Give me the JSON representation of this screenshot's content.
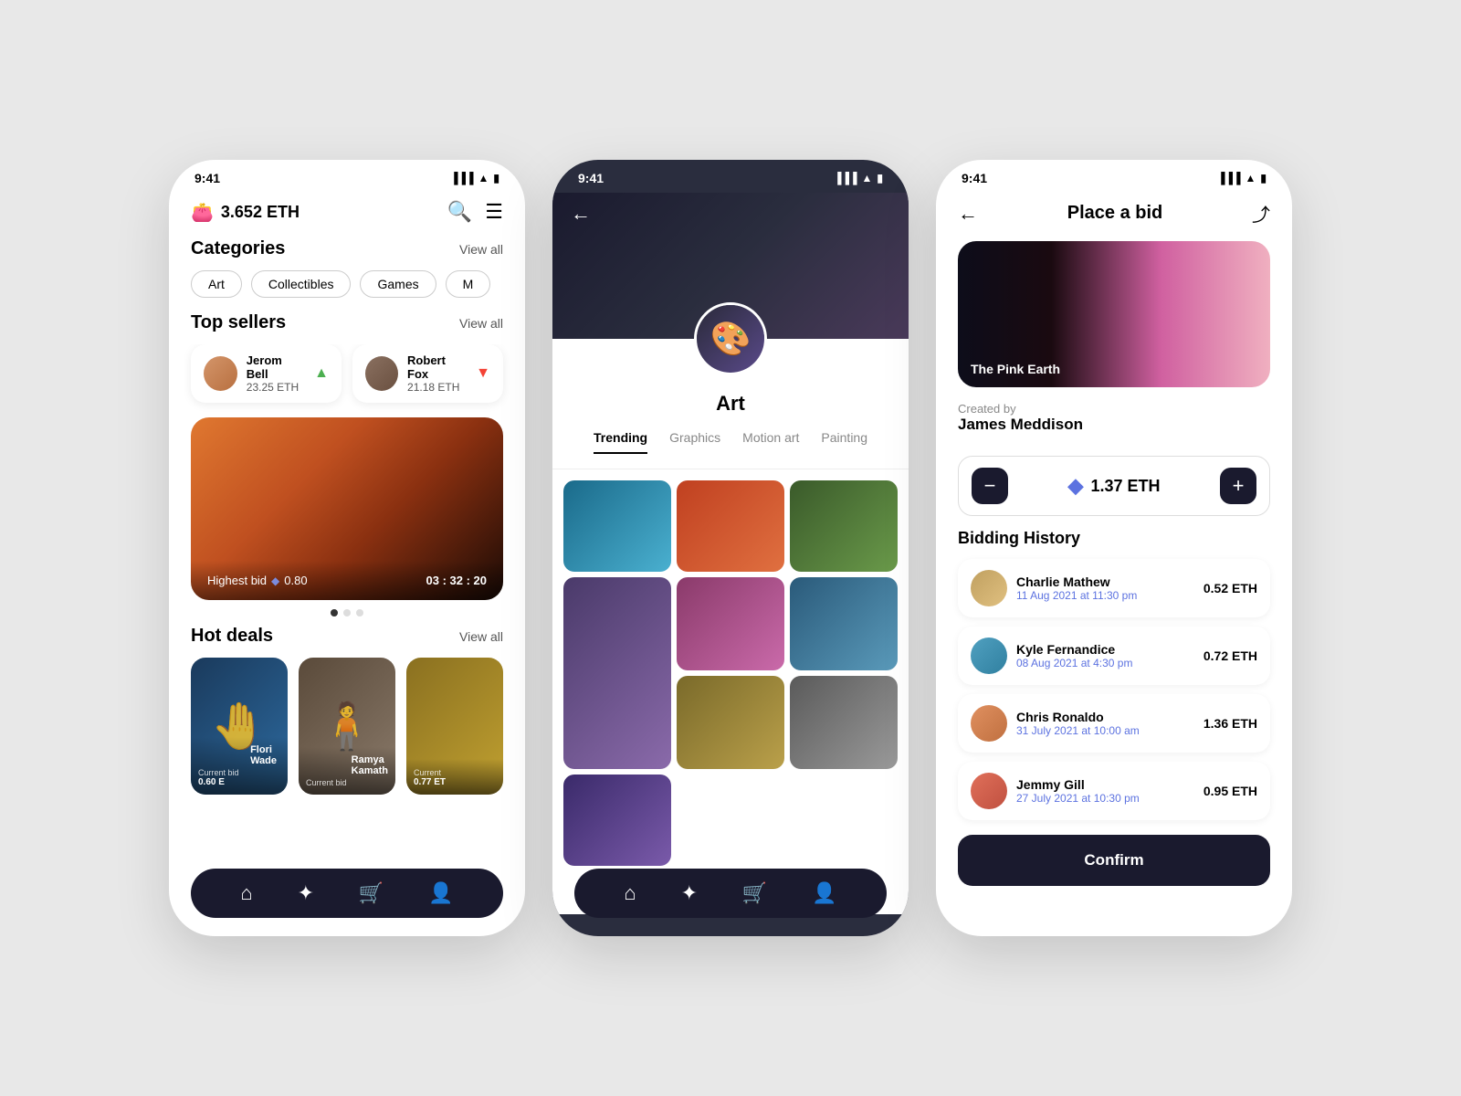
{
  "phone1": {
    "statusBar": {
      "time": "9:41"
    },
    "wallet": {
      "amount": "3.652 ETH"
    },
    "categories": {
      "title": "Categories",
      "viewAll": "View all",
      "items": [
        "Art",
        "Collectibles",
        "Games",
        "M"
      ]
    },
    "topSellers": {
      "title": "Top sellers",
      "viewAll": "View all",
      "sellers": [
        {
          "name": "Jerom Bell",
          "amount": "23.25 ETH",
          "trend": "up"
        },
        {
          "name": "Robert Fox",
          "amount": "21.18 ETH",
          "trend": "down"
        }
      ]
    },
    "featured": {
      "bidLabel": "Highest bid",
      "bidAmount": "0.80",
      "timer": "03 : 32 : 20"
    },
    "hotDeals": {
      "title": "Hot deals",
      "viewAll": "View all",
      "items": [
        {
          "creator": "Flori Wade",
          "bidLabel": "Current bid",
          "amount": "0.60 E"
        },
        {
          "creator": "Ramya Kamath",
          "bidLabel": "Current bid",
          "amount": ""
        },
        {
          "creator": "",
          "bidLabel": "Current",
          "amount": "0.77 ET"
        }
      ]
    },
    "nav": {
      "items": [
        "home",
        "compass",
        "cart",
        "user"
      ]
    }
  },
  "phone2": {
    "statusBar": {
      "time": "9:41"
    },
    "category": "Art",
    "tabs": [
      "Trending",
      "Graphics",
      "Motion art",
      "Painting"
    ],
    "activeTab": "Trending",
    "nav": {
      "items": [
        "home",
        "compass",
        "cart",
        "user"
      ]
    }
  },
  "phone3": {
    "statusBar": {
      "time": "9:41"
    },
    "pageTitle": "Place a bid",
    "artwork": {
      "title": "The Pink Earth",
      "createdBy": "Created by",
      "creator": "James Meddison"
    },
    "bidding": {
      "minus": "−",
      "amount": "1.37 ETH",
      "plus": "+"
    },
    "biddingHistoryTitle": "Bidding History",
    "bids": [
      {
        "name": "Charlie Mathew",
        "date": "11 Aug 2021 at 11:30 pm",
        "amount": "0.52 ETH"
      },
      {
        "name": "Kyle Fernandice",
        "date": "08 Aug 2021 at 4:30 pm",
        "amount": "0.72 ETH"
      },
      {
        "name": "Chris Ronaldo",
        "date": "31 July 2021 at 10:00 am",
        "amount": "1.36 ETH"
      },
      {
        "name": "Jemmy Gill",
        "date": "27 July 2021 at 10:30 pm",
        "amount": "0.95 ETH"
      }
    ],
    "confirmButton": "Confirm"
  }
}
